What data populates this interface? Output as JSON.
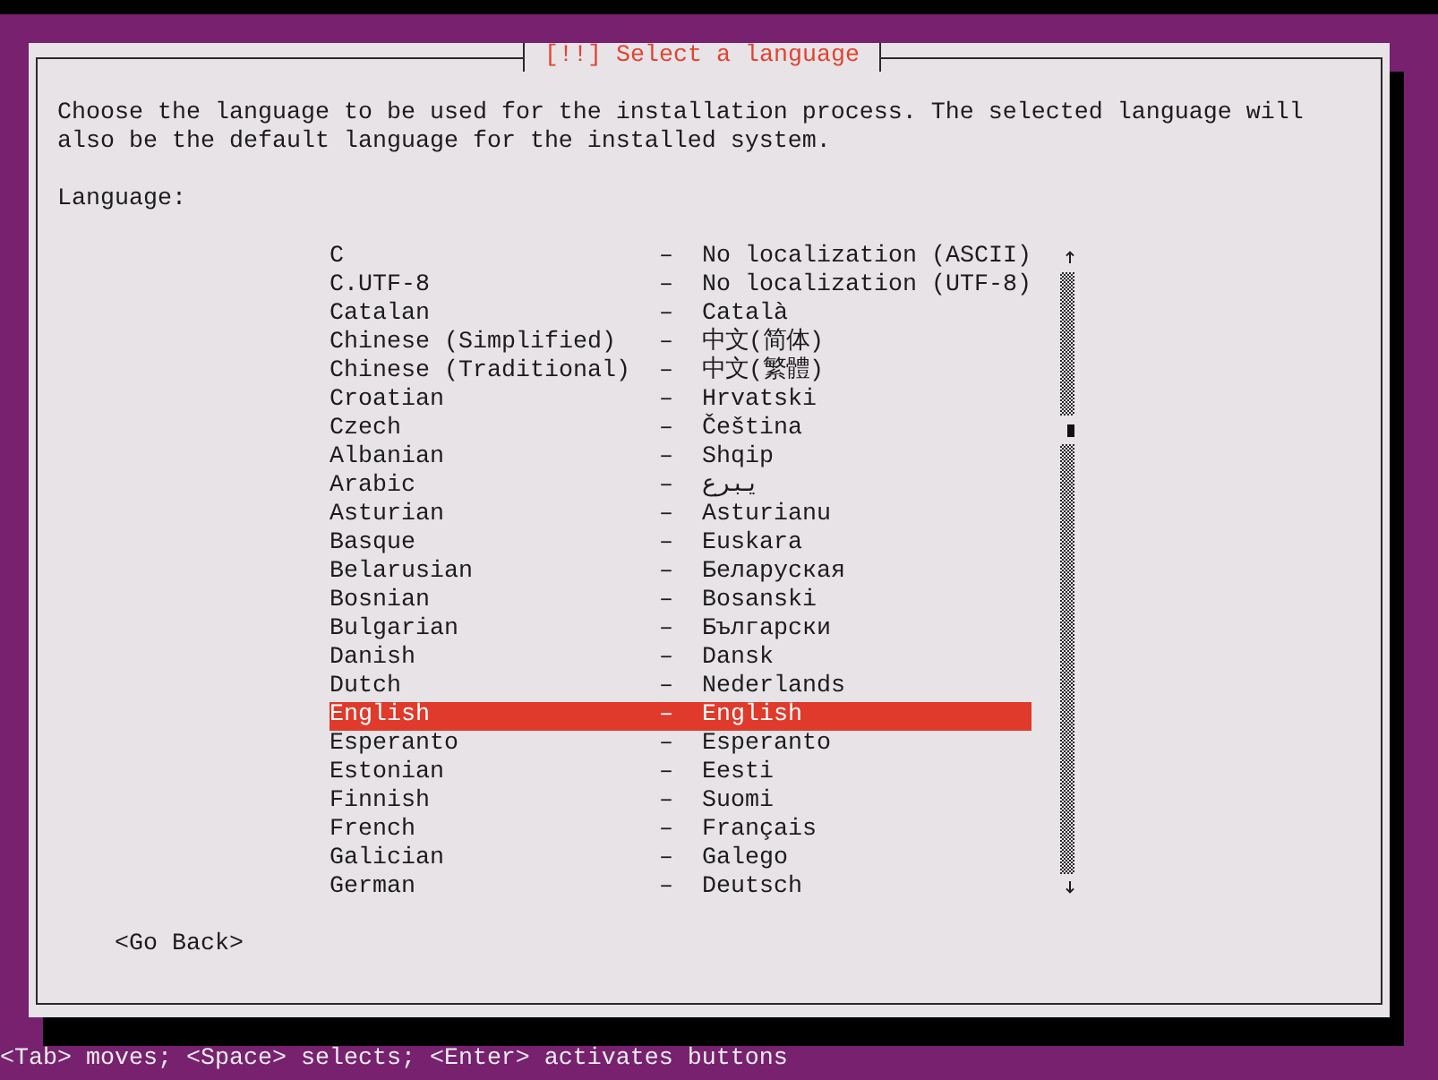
{
  "window": {
    "title": "[!!] Select a language"
  },
  "description": "Choose the language to be used for the installation process. The selected language will also be the default language for the installed system.",
  "list_label": "Language:",
  "languages": [
    {
      "name": "C",
      "separator": "–",
      "native_name": "No localization (ASCII)",
      "selected": false
    },
    {
      "name": "C.UTF-8",
      "separator": "–",
      "native_name": "No localization (UTF-8)",
      "selected": false
    },
    {
      "name": "Catalan",
      "separator": "–",
      "native_name": "Català",
      "selected": false
    },
    {
      "name": "Chinese (Simplified)",
      "separator": "–",
      "native_name": "中文(简体)",
      "selected": false
    },
    {
      "name": "Chinese (Traditional)",
      "separator": "–",
      "native_name": "中文(繁體)",
      "selected": false
    },
    {
      "name": "Croatian",
      "separator": "–",
      "native_name": "Hrvatski",
      "selected": false
    },
    {
      "name": "Czech",
      "separator": "–",
      "native_name": "Čeština",
      "selected": false
    },
    {
      "name": "Albanian",
      "separator": "–",
      "native_name": "Shqip",
      "selected": false
    },
    {
      "name": "Arabic",
      "separator": "–",
      "native_name": "عربي",
      "selected": false
    },
    {
      "name": "Asturian",
      "separator": "–",
      "native_name": "Asturianu",
      "selected": false
    },
    {
      "name": "Basque",
      "separator": "–",
      "native_name": "Euskara",
      "selected": false
    },
    {
      "name": "Belarusian",
      "separator": "–",
      "native_name": "Беларуская",
      "selected": false
    },
    {
      "name": "Bosnian",
      "separator": "–",
      "native_name": "Bosanski",
      "selected": false
    },
    {
      "name": "Bulgarian",
      "separator": "–",
      "native_name": "Български",
      "selected": false
    },
    {
      "name": "Danish",
      "separator": "–",
      "native_name": "Dansk",
      "selected": false
    },
    {
      "name": "Dutch",
      "separator": "–",
      "native_name": "Nederlands",
      "selected": false
    },
    {
      "name": "English",
      "separator": "–",
      "native_name": "English",
      "selected": true
    },
    {
      "name": "Esperanto",
      "separator": "–",
      "native_name": "Esperanto",
      "selected": false
    },
    {
      "name": "Estonian",
      "separator": "–",
      "native_name": "Eesti",
      "selected": false
    },
    {
      "name": "Finnish",
      "separator": "–",
      "native_name": "Suomi",
      "selected": false
    },
    {
      "name": "French",
      "separator": "–",
      "native_name": "Français",
      "selected": false
    },
    {
      "name": "Galician",
      "separator": "–",
      "native_name": "Galego",
      "selected": false
    },
    {
      "name": "German",
      "separator": "–",
      "native_name": "Deutsch",
      "selected": false
    }
  ],
  "buttons": [
    "<Go Back>"
  ],
  "status_bar": "<Tab> moves; <Space> selects; <Enter> activates buttons"
}
